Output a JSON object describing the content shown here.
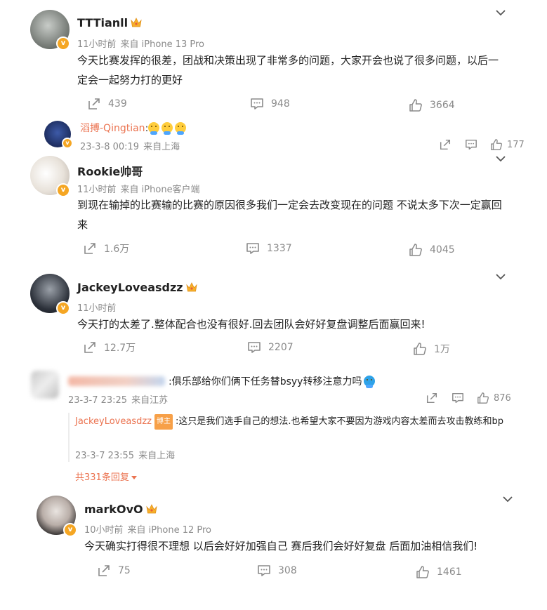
{
  "comments": [
    {
      "username": "TTTianll",
      "time": "11小时前",
      "source": "来自 iPhone 13 Pro",
      "text": "今天比赛发挥的很差，团战和决策出现了非常多的问题，大家开会也说了很多问题，以后一定会一起努力打的更好",
      "shares": "439",
      "comments": "948",
      "likes": "3664"
    },
    {
      "username": "Rookie帅哥",
      "time": "11小时前",
      "source": "来自 iPhone客户端",
      "text": "到现在输掉的比赛输的比赛的原因很多我们一定会去改变现在的问题 不说太多下次一定赢回来",
      "shares": "1.6万",
      "comments": "1337",
      "likes": "4045"
    },
    {
      "username": "JackeyLoveasdzz",
      "time": "11小时前",
      "source": "",
      "text": "今天打的太差了.整体配合也没有很好.回去团队会好好复盘调整后面赢回来!",
      "shares": "12.7万",
      "comments": "2207",
      "likes": "1万"
    },
    {
      "username": "markOvO",
      "time": "10小时前",
      "source": "来自 iPhone 12 Pro",
      "text": "今天确实打得很不理想 以后会好好加强自己 赛后我们会好好复盘 后面加油相信我们!",
      "shares": "75",
      "comments": "308",
      "likes": "1461"
    }
  ],
  "reply1": {
    "username": "滔搏-Qingtian",
    "colon": ":",
    "date": "23-3-8 00:19",
    "location": "来自上海",
    "likes": "177"
  },
  "reply2": {
    "text": ":俱乐部给你们俩下任务替bsyy转移注意力吗",
    "date": "23-3-7 23:25",
    "location": "来自江苏",
    "likes": "876",
    "sub_username": "JackeyLoveasdzz",
    "sub_tag": "博主",
    "sub_text": ":这只是我们选手自己的想法.也希望大家不要因为游戏内容太差而去攻击教练和bp",
    "sub_date": "23-3-7 23:55",
    "sub_location": "来自上海",
    "more_replies": "共331条回复"
  },
  "icons": {
    "share": "share-icon",
    "comment": "comment-icon",
    "like": "thumbs-up-icon",
    "chevron": "chevron-down-icon",
    "crown": "crown-badge-icon",
    "verified": "verified-badge-icon"
  },
  "colors": {
    "accent": "#eb7350",
    "badge": "#f5a623",
    "meta": "#8a8a8a"
  }
}
